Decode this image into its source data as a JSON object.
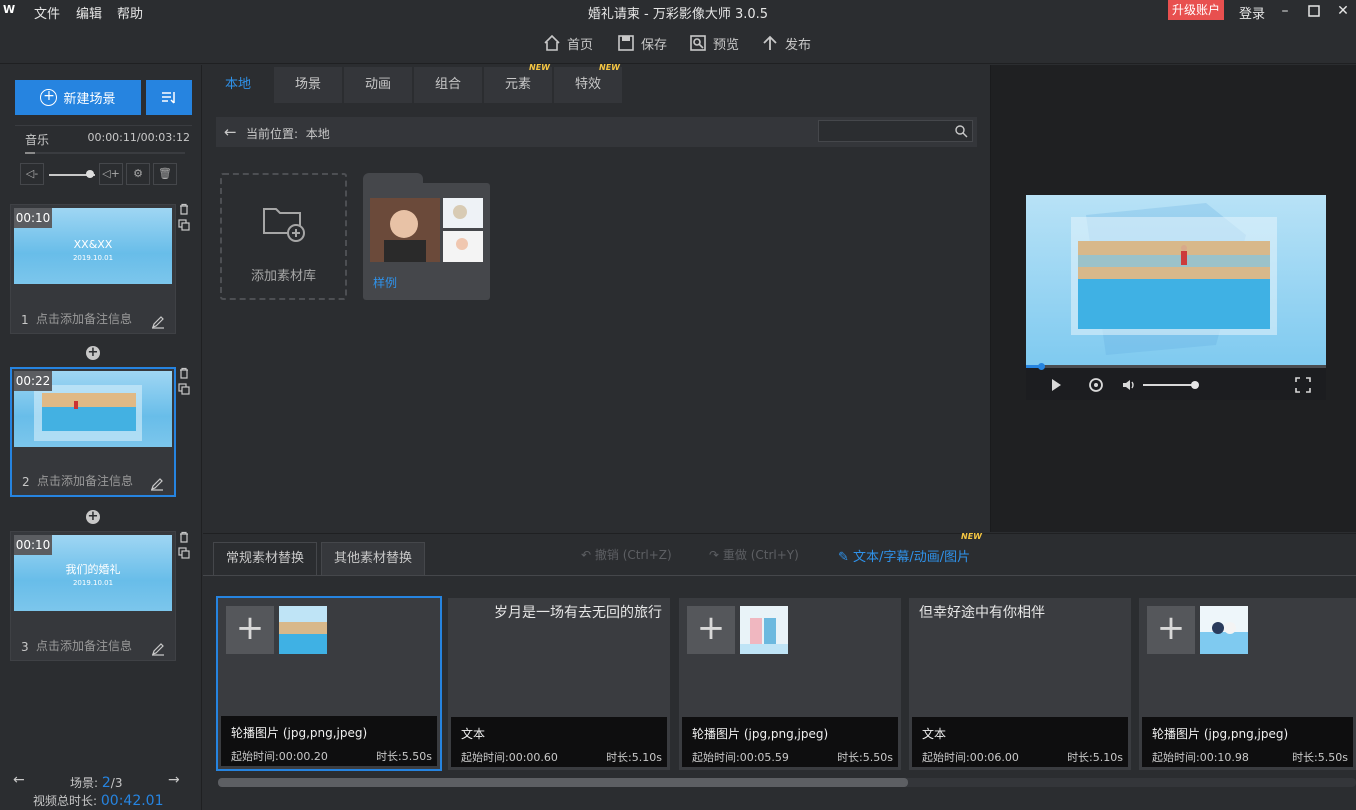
{
  "window": {
    "title": "婚礼请柬 - 万彩影像大师 3.0.5",
    "logo": "W",
    "menus": [
      "文件",
      "编辑",
      "帮助"
    ],
    "upgrade": "升级账户",
    "login": "登录"
  },
  "toolbar": {
    "home": "首页",
    "save": "保存",
    "preview": "预览",
    "publish": "发布"
  },
  "left": {
    "new_scene": "新建场景",
    "music_label": "音乐",
    "music_time": "00:00:11/00:03:12",
    "music_progress": 0.06,
    "volume": 0.9,
    "scenes": [
      {
        "duration": "00:10",
        "index": "1",
        "note": "点击添加备注信息",
        "caption": "XX&XX",
        "caption2": "2019.10.01"
      },
      {
        "duration": "00:22",
        "index": "2",
        "note": "点击添加备注信息",
        "caption": "",
        "caption2": ""
      },
      {
        "duration": "00:10",
        "index": "3",
        "note": "点击添加备注信息",
        "caption": "我们的婚礼",
        "caption2": "2019.10.01"
      }
    ],
    "scene_label": "场景:",
    "scene_current": "2",
    "scene_total": "/3",
    "total_label": "视频总时长:",
    "total_value": "00:42.01"
  },
  "center": {
    "tabs": [
      "本地",
      "场景",
      "动画",
      "组合",
      "元素",
      "特效"
    ],
    "new_badge": "NEW",
    "path_label": "当前位置:",
    "path_value": "本地",
    "search_placeholder": "",
    "add_library": "添加素材库",
    "folder_name": "样例"
  },
  "bottom": {
    "tab_regular": "常规素材替换",
    "tab_other": "其他素材替换",
    "undo": "撤销 (Ctrl+Z)",
    "redo": "重做 (Ctrl+Y)",
    "text_edit": "文本/字幕/动画/图片",
    "new_badge": "NEW",
    "cards": [
      {
        "kind": "image",
        "type": "轮播图片 (jpg,png,jpeg)",
        "start": "起始时间:00:00.20",
        "length": "时长:5.50s"
      },
      {
        "kind": "text",
        "text": "岁月是一场有去无回的旅行",
        "type": "文本",
        "start": "起始时间:00:00.60",
        "length": "时长:5.10s"
      },
      {
        "kind": "image",
        "type": "轮播图片 (jpg,png,jpeg)",
        "start": "起始时间:00:05.59",
        "length": "时长:5.50s"
      },
      {
        "kind": "text",
        "text": "但幸好途中有你相伴",
        "type": "文本",
        "start": "起始时间:00:06.00",
        "length": "时长:5.10s"
      },
      {
        "kind": "image",
        "type": "轮播图片 (jpg,png,jpeg)",
        "start": "起始时间:00:10.98",
        "length": "时长:5.50s"
      }
    ]
  },
  "colors": {
    "accent": "#2684e0",
    "upgrade": "#e8504f",
    "badge": "#f4c542"
  }
}
